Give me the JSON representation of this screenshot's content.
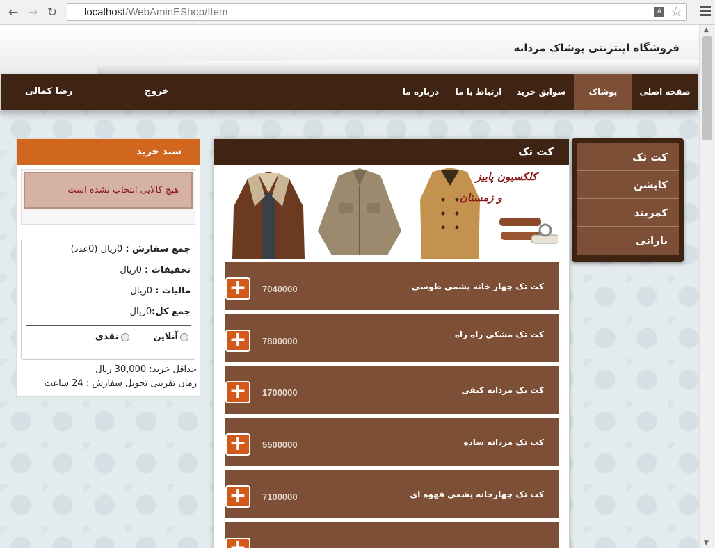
{
  "browser": {
    "url_host": "localhost",
    "url_path": "/WebAminEShop/Item"
  },
  "site": {
    "title": "فروشگاه اینترنتی پوشاک مردانه"
  },
  "nav": {
    "items": [
      "صفحه اصلی",
      "پوشاک",
      "سوابق خرید",
      "ارتباط با ما",
      "درباره ما"
    ],
    "logout": "خروج",
    "user": "رضا کمالی"
  },
  "categories": [
    "کت تک",
    "کاپشن",
    "کمربند",
    "بارانی"
  ],
  "products": {
    "heading": "کت تک",
    "banner_line1": "کلکسیون پاییز",
    "banner_line2": "و  زمستان",
    "items": [
      {
        "name": "کت تک چهار خانه پشمی طوسی",
        "price": "7040000"
      },
      {
        "name": "کت تک مشکی راه راه",
        "price": "7800000"
      },
      {
        "name": "کت تک مردانه کنفی",
        "price": "1700000"
      },
      {
        "name": "کت تک مردانه ساده",
        "price": "5500000"
      },
      {
        "name": "کت تک چهارخانه پشمی قهوه ای",
        "price": "7100000"
      }
    ]
  },
  "cart": {
    "heading": "سبد خرید",
    "empty_message": "هیچ کالایی انتخاب نشده است",
    "order_total_label": "جمع سفارش :",
    "order_total_value": "0ریال  (0عدد)",
    "discount_label": "تخفیفات :",
    "discount_value": "0ریال",
    "tax_label": "مالیات :",
    "tax_value": "0ریال",
    "grand_total_label": "جمع کل:",
    "grand_total_value": "0ریال",
    "pay_online": "آنلاین",
    "pay_cash": "نقدی",
    "min_purchase": "حداقل خرید: 30,000 ریال",
    "delivery_time": "زمان تقریبی تحویل سفارش : 24 ساعت"
  }
}
